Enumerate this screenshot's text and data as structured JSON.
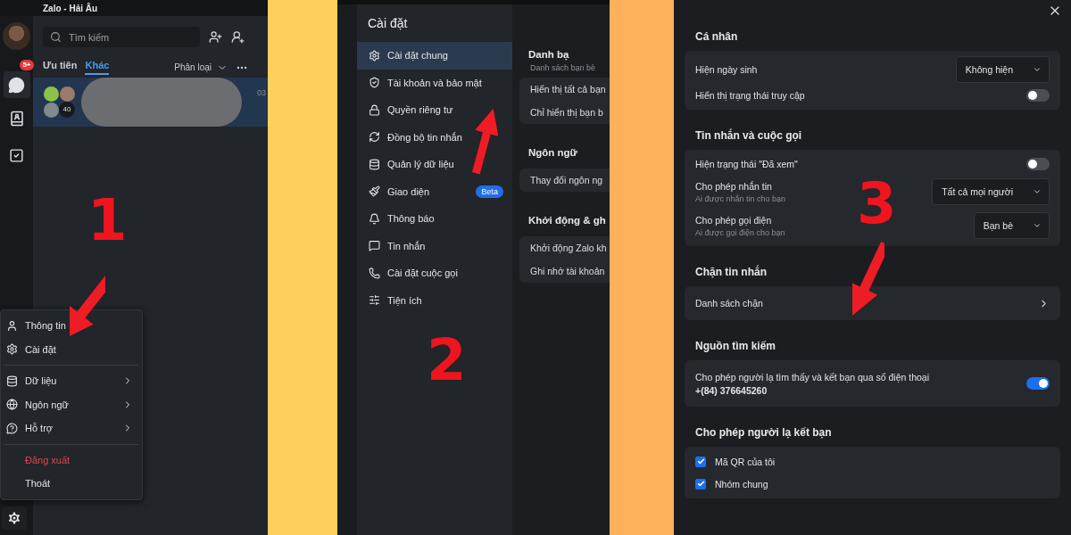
{
  "chat_window": {
    "title": "Zalo - Hải Âu",
    "unread_badge": "5+",
    "search": {
      "placeholder": "Tìm kiếm"
    },
    "tabs": [
      {
        "label": "Ưu tiên",
        "selected": false
      },
      {
        "label": "Khác",
        "selected": true
      }
    ],
    "filter": "Phân loại",
    "conversations": [
      {
        "member_count": "40",
        "time": "03",
        "selected": true
      }
    ],
    "menu": {
      "groups": [
        [
          {
            "label": "Thông tin",
            "kind": "action"
          },
          {
            "label": "Cài đặt",
            "kind": "action"
          }
        ],
        [
          {
            "label": "Dữ liệu",
            "kind": "submenu"
          },
          {
            "label": "Ngôn ngữ",
            "kind": "submenu"
          },
          {
            "label": "Hỗ trợ",
            "kind": "submenu"
          }
        ],
        [
          {
            "label": "Đăng xuất",
            "kind": "danger"
          },
          {
            "label": "Thoát",
            "kind": "plain"
          }
        ]
      ]
    },
    "step": "1"
  },
  "settings_window": {
    "title": "Cài đặt",
    "nav": [
      {
        "label": "Cài đặt chung",
        "selected": true
      },
      {
        "label": "Tài khoản và bảo mật",
        "selected": false
      },
      {
        "label": "Quyền riêng tư",
        "selected": false
      },
      {
        "label": "Đồng bộ tin nhắn",
        "selected": false
      },
      {
        "label": "Quản lý dữ liệu",
        "selected": false
      },
      {
        "label": "Giao diện",
        "selected": false,
        "badge": "Beta"
      },
      {
        "label": "Thông báo",
        "selected": false
      },
      {
        "label": "Tin nhắn",
        "selected": false
      },
      {
        "label": "Cài đặt cuộc gọi",
        "selected": false
      },
      {
        "label": "Tiện ích",
        "selected": false
      }
    ],
    "sections": [
      {
        "heading": "Danh bạ",
        "subtitle": "Danh sách bạn bè",
        "rows": [
          "Hiển thị tất cả bạn",
          "Chỉ hiển thị bạn b"
        ]
      },
      {
        "heading": "Ngôn ngữ",
        "rows": [
          "Thay đổi ngôn ng"
        ]
      },
      {
        "heading": "Khởi động & gh",
        "rows": [
          "Khởi động Zalo kh",
          "Ghi nhớ tài khoản"
        ]
      }
    ],
    "step": "2"
  },
  "privacy_window": {
    "sections": [
      {
        "heading": "Cá nhân",
        "rows": [
          {
            "kind": "select",
            "label": "Hiện ngày sinh",
            "value": "Không hiện"
          },
          {
            "kind": "toggle",
            "label": "Hiển thị trạng thái truy cập",
            "on": false
          }
        ]
      },
      {
        "heading": "Tin nhắn và cuộc gọi",
        "rows": [
          {
            "kind": "toggle",
            "label": "Hiện trạng thái \"Đã xem\"",
            "on": false
          },
          {
            "kind": "select",
            "label": "Cho phép nhắn tin",
            "hint": "Ai được nhắn tin cho bạn",
            "value": "Tất cả mọi người"
          },
          {
            "kind": "select",
            "label": "Cho phép gọi điện",
            "hint": "Ai được gọi điện cho bạn",
            "value": "Bạn bè"
          }
        ]
      },
      {
        "heading": "Chặn tin nhắn",
        "rows": [
          {
            "kind": "link",
            "label": "Danh sách chặn"
          }
        ]
      },
      {
        "heading": "Nguồn tìm kiếm",
        "rows": [
          {
            "kind": "toggle",
            "label": "Cho phép người lạ tìm thấy và kết bạn qua số điện thoại",
            "detail": "+(84) 376645260",
            "on": true
          }
        ]
      },
      {
        "heading": "Cho phép người lạ kết bạn",
        "rows": [
          {
            "kind": "checkbox",
            "label": "Mã QR của tôi",
            "checked": true
          },
          {
            "kind": "checkbox",
            "label": "Nhóm chung",
            "checked": true
          }
        ]
      }
    ],
    "step": "3"
  }
}
